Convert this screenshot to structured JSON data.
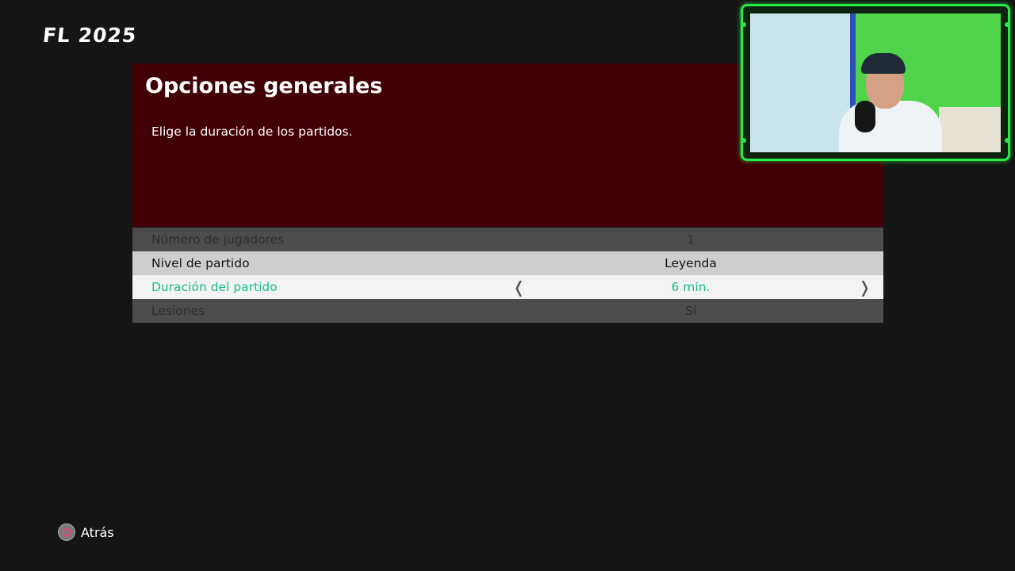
{
  "app": {
    "logo_text": "FL 2025"
  },
  "panel": {
    "title": "Opciones generales",
    "description": "Elige la duración de los partidos."
  },
  "options": [
    {
      "label": "Número de jugadores",
      "value": "1",
      "state": "disabled"
    },
    {
      "label": "Nivel de partido",
      "value": "Leyenda",
      "state": "normal"
    },
    {
      "label": "Duración del partido",
      "value": "6 min.",
      "state": "selected",
      "left_arrow": "❬",
      "right_arrow": "❭"
    },
    {
      "label": "Lesiones",
      "value": "Sí",
      "state": "disabled"
    }
  ],
  "footer": {
    "back_label": "Atrás",
    "back_icon": "circle-button-icon"
  },
  "colors": {
    "background": "#151515",
    "panel": "#410006",
    "selected_text": "#1abf85",
    "webcam_border": "#29e84a"
  }
}
